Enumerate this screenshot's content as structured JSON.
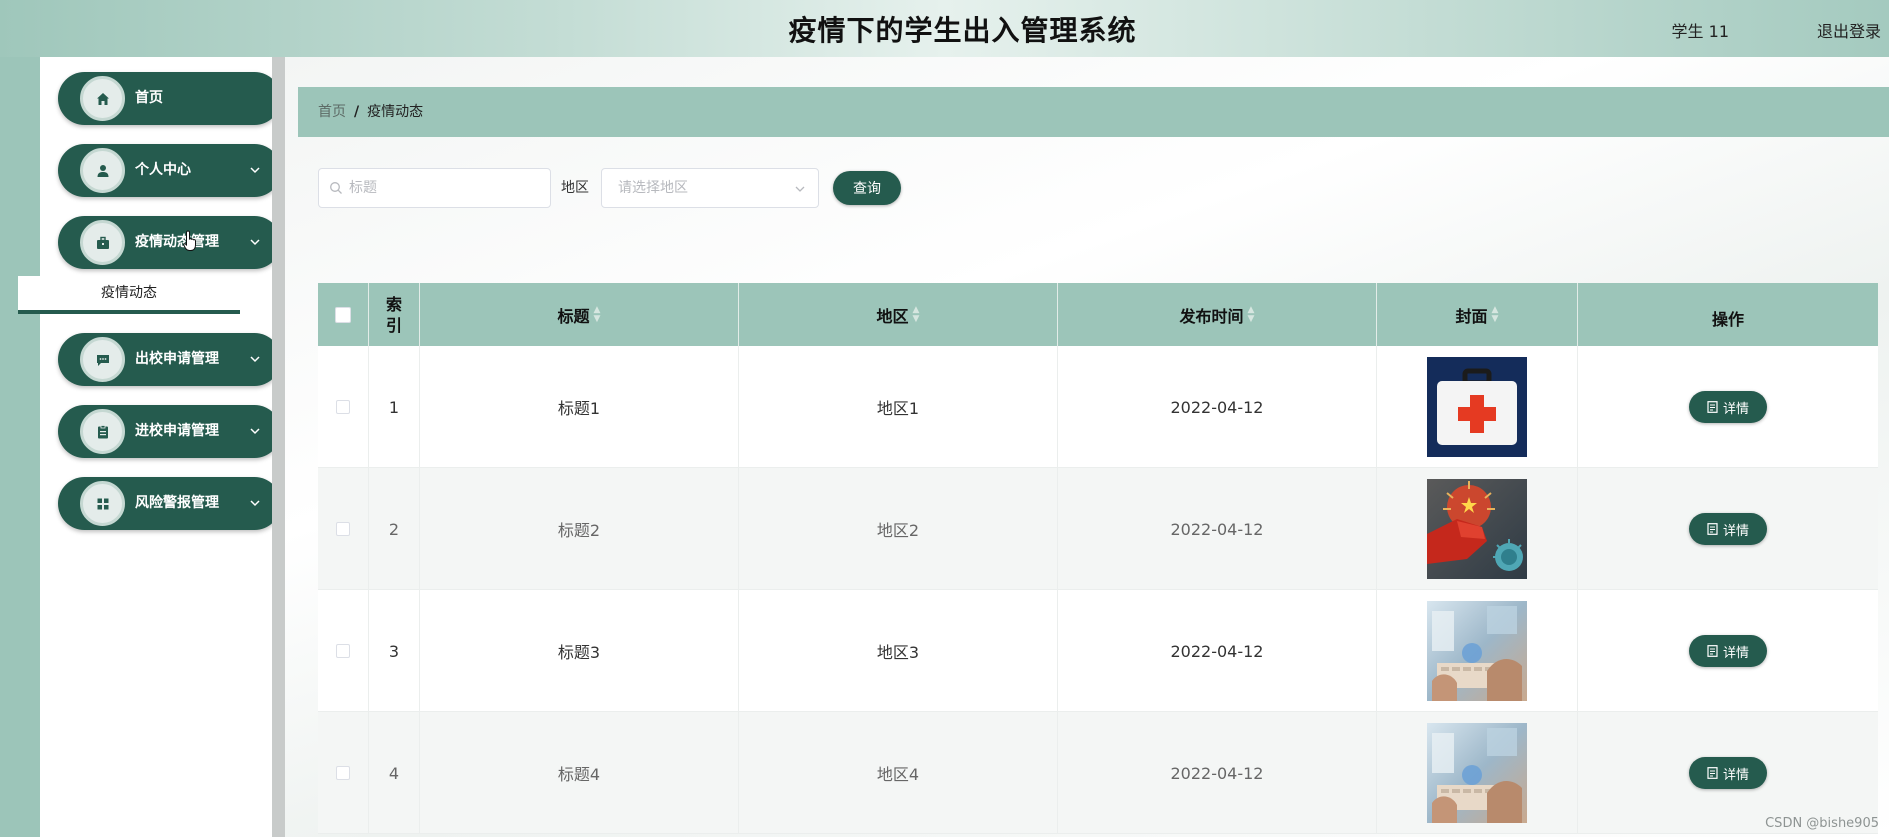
{
  "header": {
    "title": "疫情下的学生出入管理系统",
    "user": "学生 11",
    "logout": "退出登录"
  },
  "sidebar": {
    "items": [
      {
        "label": "首页",
        "icon": "home-icon"
      },
      {
        "label": "个人中心",
        "icon": "user-icon"
      },
      {
        "label": "疫情动态管理",
        "icon": "briefcase-icon"
      },
      {
        "label": "出校申请管理",
        "icon": "message-icon"
      },
      {
        "label": "进校申请管理",
        "icon": "clipboard-icon"
      },
      {
        "label": "风险警报管理",
        "icon": "grid-icon"
      }
    ],
    "submenu": "疫情动态"
  },
  "breadcrumb": {
    "home": "首页",
    "sep": "/",
    "current": "疫情动态"
  },
  "search": {
    "placeholder": "标题",
    "region_label": "地区",
    "region_placeholder": "请选择地区",
    "query_label": "查询"
  },
  "table": {
    "headers": {
      "index": "索引",
      "title": "标题",
      "region": "地区",
      "time": "发布时间",
      "cover": "封面",
      "action": "操作"
    },
    "rows": [
      {
        "index": "1",
        "title": "标题1",
        "region": "地区1",
        "time": "2022-04-12",
        "cover": "first-aid-kit",
        "action": "详情"
      },
      {
        "index": "2",
        "title": "标题2",
        "region": "地区2",
        "time": "2022-04-12",
        "cover": "fist-vs-virus",
        "action": "详情"
      },
      {
        "index": "3",
        "title": "标题3",
        "region": "地区3",
        "time": "2022-04-12",
        "cover": "data-lab",
        "action": "详情"
      },
      {
        "index": "4",
        "title": "标题4",
        "region": "地区4",
        "time": "2022-04-12",
        "cover": "data-lab",
        "action": "详情"
      }
    ]
  },
  "watermark": "CSDN @bishe905",
  "colors": {
    "primary": "#255b4e",
    "accent": "#9cc5b9"
  }
}
